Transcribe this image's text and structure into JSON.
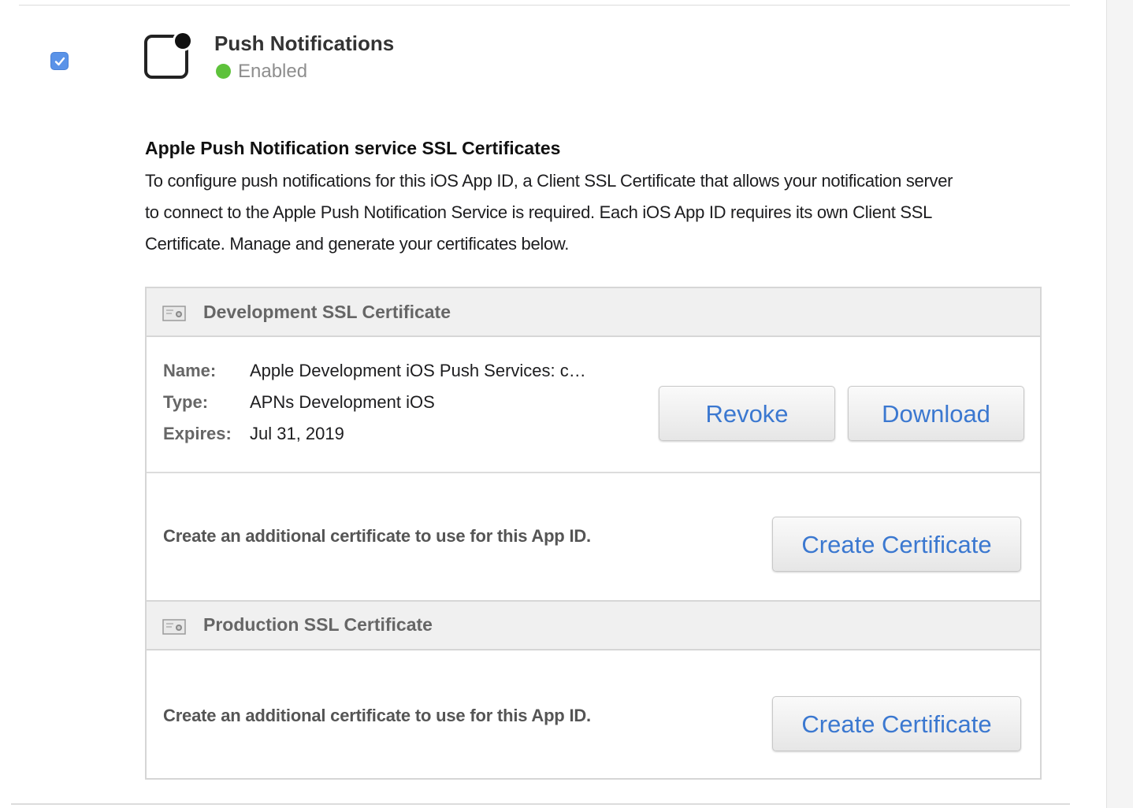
{
  "service": {
    "enabled_checkbox": true,
    "title": "Push Notifications",
    "status": "Enabled",
    "status_color": "#5ec23b",
    "icon": "push-notification-icon"
  },
  "ssl_section": {
    "heading": "Apple Push Notification service SSL Certificates",
    "description_lines": [
      "To configure push notifications for this iOS App ID, a Client SSL Certificate that allows your notification server",
      "to connect to the Apple Push Notification Service is required. Each iOS App ID requires its own Client SSL",
      "Certificate. Manage and generate your certificates below."
    ]
  },
  "development": {
    "header": "Development SSL Certificate",
    "icon": "certificate-icon",
    "fields": [
      {
        "label": "Name:",
        "value": "Apple Development iOS Push Services: c…"
      },
      {
        "label": "Type:",
        "value": "APNs Development iOS"
      },
      {
        "label": "Expires:",
        "value": "Jul 31, 2019"
      }
    ],
    "revoke_label": "Revoke",
    "download_label": "Download",
    "create_text": "Create an additional certificate to use for this App ID.",
    "create_label": "Create Certificate"
  },
  "production": {
    "header": "Production SSL Certificate",
    "icon": "certificate-icon",
    "create_text": "Create an additional certificate to use for this App ID.",
    "create_label": "Create Certificate"
  },
  "colors": {
    "accent_link": "#3b78d0",
    "checkbox": "#5a93e8"
  }
}
